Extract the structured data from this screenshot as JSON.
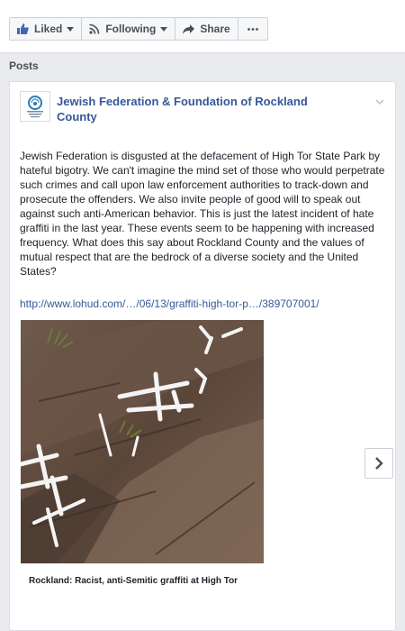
{
  "actions": {
    "liked_label": "Liked",
    "following_label": "Following",
    "share_label": "Share"
  },
  "section": {
    "title": "Posts"
  },
  "post": {
    "author": "Jewish Federation & Foundation of Rockland County",
    "body": "Jewish Federation is disgusted at the defacement of High Tor State Park by hateful bigotry. We can't imagine the mind set of those who would perpetrate such crimes and call upon law enforcement authorities to track-down and prosecute the offenders. We also invite people of good will to speak out against such anti-American behavior. This is just the latest incident of hate graffiti in the last year. These events seem to be happening with increased frequency. What does this say about Rockland County and the values of mutual respect that are the bedrock of a diverse society and the United States?",
    "link": "http://www.lohud.com/…/06/13/graffiti-high-tor-p…/389707001/",
    "caption": "Rockland: Racist, anti-Semitic graffiti at High Tor"
  },
  "colors": {
    "link": "#365899",
    "page_bg": "#e9ebee",
    "card_bg": "#ffffff"
  },
  "icons": [
    "thumbs-up-icon",
    "caret-down-icon",
    "rss-icon",
    "share-arrow-icon",
    "more-dots-icon",
    "chevron-down-icon",
    "chevron-right-icon"
  ]
}
